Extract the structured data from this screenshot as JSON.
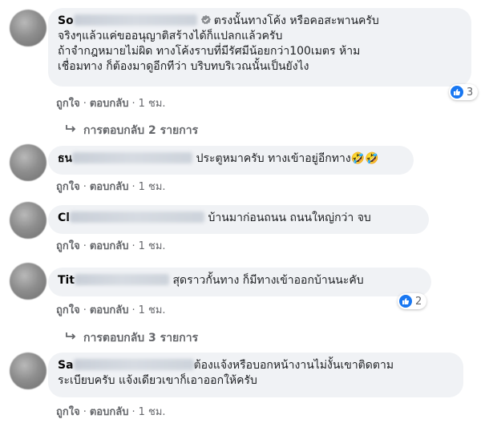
{
  "comments": [
    {
      "name_visible": "So",
      "verified": true,
      "lines": [
        "ตรงนั้นทางโค้ง หรือคอสะพานครับ",
        "จริงๆแล้วแค่ขออนุญาติสร้างได้ก็แปลกแล้วครับ",
        "ถ้าจำกฎหมายไม่ผิด ทางโค้งราบที่มีรัศมีน้อยกว่า100เมตร ห้าม",
        "เชื่อมทาง ก็ต้องมาดูอีกทีว่า บริบทบริเวณนั้นเป็นยังไง"
      ],
      "reaction_count": "3",
      "replies_label": "การตอบกลับ 2 รายการ"
    },
    {
      "name_visible": "ธน",
      "lines": [
        "ประตูหมาครับ ทางเข้าอยู่อีกทาง🤣🤣"
      ]
    },
    {
      "name_visible": "Cl",
      "lines": [
        "บ้านมาก่อนถนน ถนนใหญ่กว่า จบ"
      ]
    },
    {
      "name_visible": "Tit",
      "lines": [
        "สุดราวกั้นทาง ก็มีทางเข้าออกบ้านนะคับ"
      ],
      "reaction_count": "2",
      "replies_label": "การตอบกลับ 3 รายการ"
    },
    {
      "name_visible": "Sa",
      "lines": [
        "ต้องแจ้งหรือบอกหน้างานไม่งั้นเขาติดตาม",
        "ระเบียบครับ แจ้งเดียวเขาก็เอาออกให้ครับ"
      ]
    }
  ],
  "actions": {
    "like": "ถูกใจ",
    "reply": "ตอบกลับ",
    "dot": "·",
    "time": "1 ชม."
  },
  "colors": {
    "bubble": "#f0f2f5",
    "meta": "#65676b",
    "like_blue": "#1877f2"
  }
}
